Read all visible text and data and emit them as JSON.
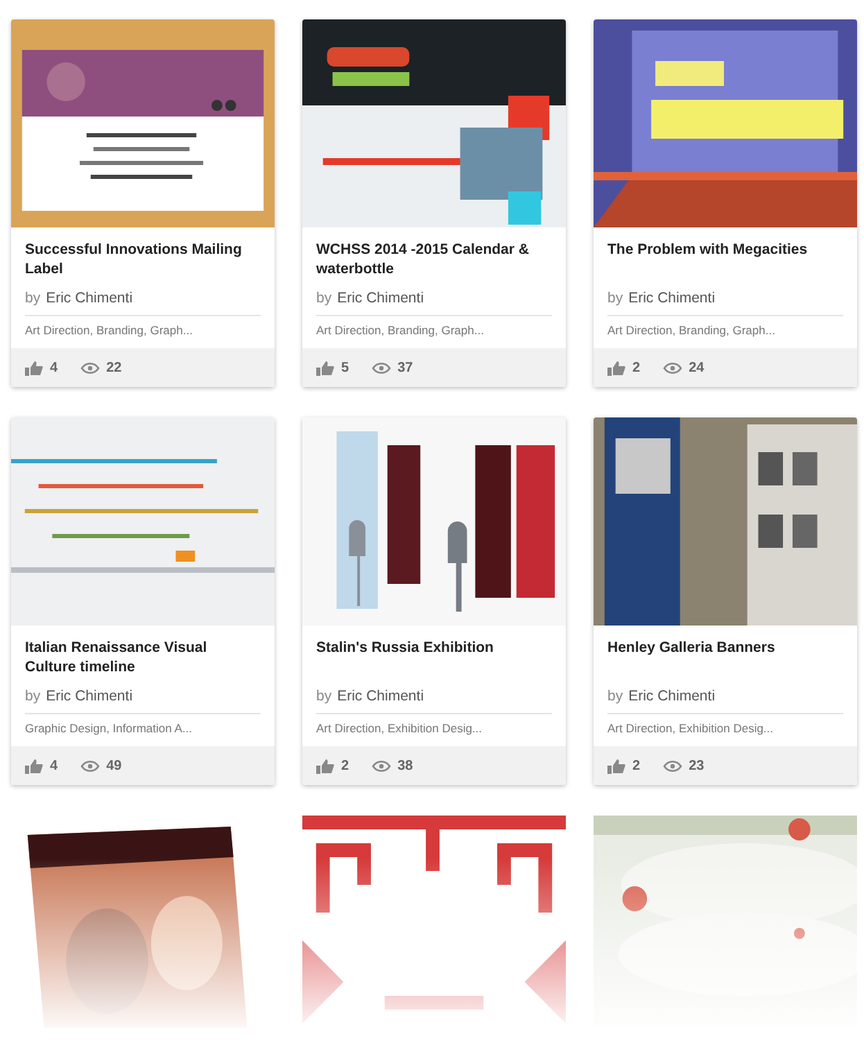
{
  "projects": [
    {
      "kind": "project",
      "title": "Successful Innovations Mailing Label",
      "by": "by",
      "author": "Eric Chimenti",
      "tags": "Art Direction, Branding, Graph...",
      "appreciations": "4",
      "views": "22"
    },
    {
      "kind": "project",
      "title": "WCHSS 2014 -2015 Calendar & waterbottle",
      "by": "by",
      "author": "Eric Chimenti",
      "tags": "Art Direction, Branding, Graph...",
      "appreciations": "5",
      "views": "37"
    },
    {
      "kind": "project",
      "title": "The Problem with Megacities",
      "by": "by",
      "author": "Eric Chimenti",
      "tags": "Art Direction, Branding, Graph...",
      "appreciations": "2",
      "views": "24"
    },
    {
      "kind": "project",
      "title": "Italian Renaissance Visual Culture timeline",
      "by": "by",
      "author": "Eric Chimenti",
      "tags": "Graphic Design, Information A...",
      "appreciations": "4",
      "views": "49"
    },
    {
      "kind": "project",
      "title": "Stalin's Russia Exhibition",
      "by": "by",
      "author": "Eric Chimenti",
      "tags": "Art Direction, Exhibition Desig...",
      "appreciations": "2",
      "views": "38"
    },
    {
      "kind": "project",
      "title": "Henley Galleria Banners",
      "by": "by",
      "author": "Eric Chimenti",
      "tags": "Art Direction, Exhibition Desig...",
      "appreciations": "2",
      "views": "23"
    },
    {
      "kind": "preview"
    },
    {
      "kind": "preview"
    },
    {
      "kind": "preview"
    }
  ]
}
